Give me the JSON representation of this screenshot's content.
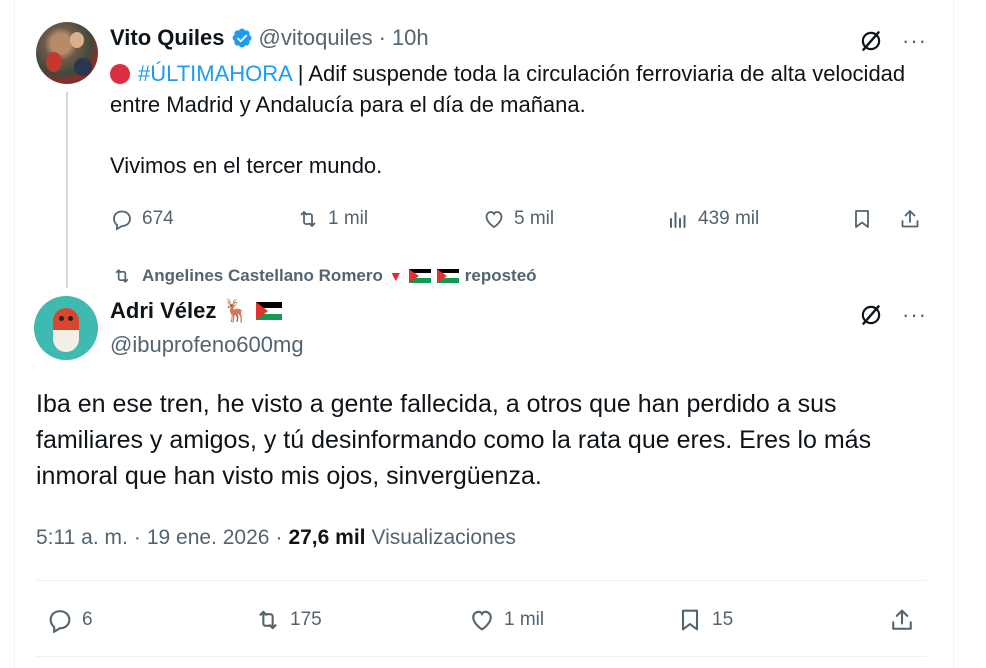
{
  "parent_tweet": {
    "author_name": "Vito Quiles",
    "handle": "@vitoquiles",
    "separator": "·",
    "time": "10h",
    "hashtag": "#ÚLTIMAHORA",
    "text_line1": " | Adif suspende toda la circulación ferroviaria de alta velocidad entre Madrid y Andalucía para el día de mañana.",
    "text_line2": "Vivimos en el tercer mundo.",
    "actions": {
      "replies": "674",
      "reposts": "1 mil",
      "likes": "5 mil",
      "views": "439 mil"
    }
  },
  "repost_notice": {
    "user": "Angelines Castellano Romero",
    "heart_glyph": "▼",
    "label": "reposteó"
  },
  "main_tweet": {
    "author_name": "Adri Vélez",
    "name_emoji": "🦌",
    "handle": "@ibuprofeno600mg",
    "text": "Iba en ese tren, he visto a gente fallecida, a otros que han perdido a sus familiares y amigos, y tú desinformando como la rata que eres. Eres lo más inmoral que han visto mis ojos, sinvergüenza.",
    "timestamp": "5:11 a. m.",
    "separator": "·",
    "date": "19 ene. 2026",
    "separator2": "·",
    "views_count": "27,6 mil",
    "views_label": "Visualizaciones",
    "actions": {
      "replies": "6",
      "reposts": "175",
      "likes": "1 mil",
      "bookmarks": "15"
    }
  },
  "more_glyph": "···",
  "colors": {
    "accent": "#1d9bf0",
    "muted_text": "#536471",
    "primary_text": "#0f1419",
    "divider": "#eff3f4"
  }
}
